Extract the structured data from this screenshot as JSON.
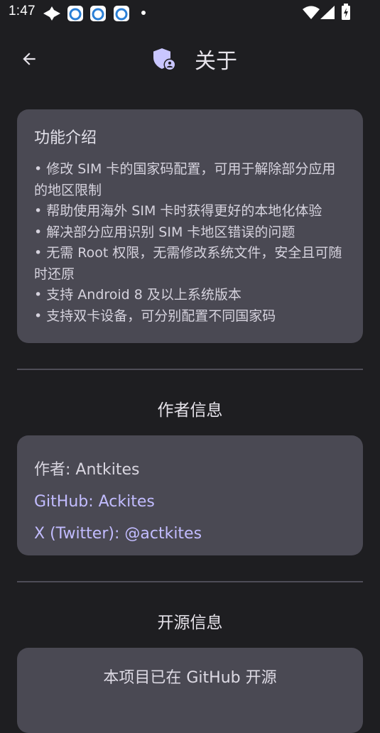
{
  "status_bar": {
    "time": "1:47",
    "icons": [
      "diamond-network-icon",
      "app-notification-icon",
      "app-notification-icon",
      "app-notification-icon",
      "dot-icon",
      "wifi-icon",
      "signal-icon",
      "battery-charging-icon"
    ]
  },
  "app_bar": {
    "title": "关于",
    "back_icon": "arrow-back-icon",
    "logo_icon": "shield-user-icon"
  },
  "features": {
    "heading": "功能介绍",
    "items": [
      "• 修改 SIM 卡的国家码配置，可用于解除部分应用的地区限制",
      "• 帮助使用海外 SIM 卡时获得更好的本地化体验",
      "• 解决部分应用识别 SIM 卡地区错误的问题",
      "• 无需 Root 权限，无需修改系统文件，安全且可随时还原",
      "• 支持 Android 8 及以上系统版本",
      "• 支持双卡设备，可分别配置不同国家码"
    ]
  },
  "author": {
    "section_title": "作者信息",
    "name": "作者: Antkites",
    "github": "GitHub: Ackites",
    "twitter": "X (Twitter): @actkites"
  },
  "open_source": {
    "section_title": "开源信息",
    "text": "本项目已在 GitHub 开源"
  },
  "colors": {
    "background": "#1e1e21",
    "card": "#4a4953",
    "link": "#c2bcff",
    "logo": "#c9c6ff"
  }
}
